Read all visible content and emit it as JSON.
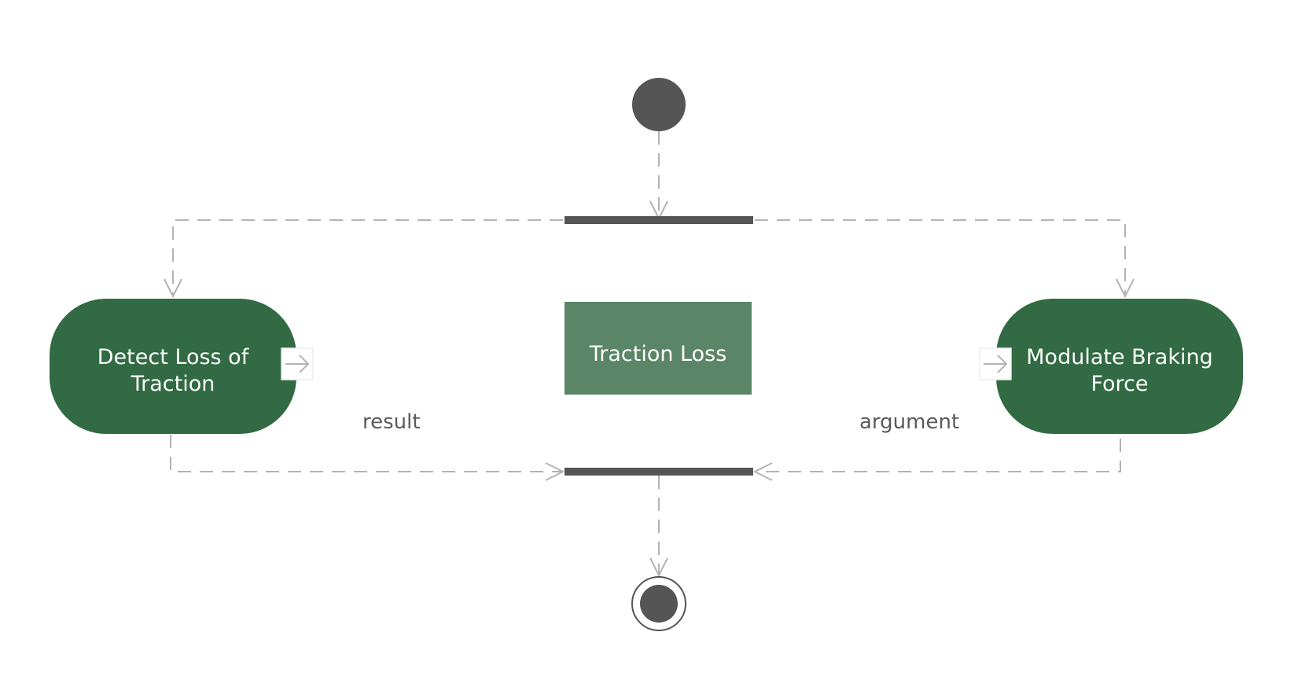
{
  "diagram": {
    "type": "UML activity diagram",
    "colors": {
      "action_fill": "#316a43",
      "object_fill": "#5a8566",
      "control_fill": "#555555",
      "flow_stroke": "#b3b3b3",
      "label_text": "#5a5a5a",
      "node_text": "#ffffff",
      "pin_fill": "#ffffff",
      "pin_stroke": "#eeeeee"
    },
    "nodes": {
      "initial": {
        "kind": "initial-node"
      },
      "fork": {
        "kind": "fork-bar"
      },
      "action_left": {
        "kind": "action",
        "lines": [
          "Detect Loss of",
          "Traction"
        ],
        "pin": "output"
      },
      "object": {
        "kind": "object-node",
        "label": "Traction Loss"
      },
      "action_right": {
        "kind": "action",
        "lines": [
          "Modulate Braking",
          "Force"
        ],
        "pin": "input"
      },
      "join": {
        "kind": "join-bar"
      },
      "final": {
        "kind": "final-node"
      }
    },
    "labels": {
      "result": "result",
      "argument": "argument"
    },
    "flows": [
      {
        "from": "initial",
        "to": "fork"
      },
      {
        "from": "fork",
        "to": "action_left"
      },
      {
        "from": "fork",
        "to": "action_right"
      },
      {
        "from": "action_left",
        "to": "join"
      },
      {
        "from": "action_right",
        "to": "join"
      },
      {
        "from": "join",
        "to": "final"
      }
    ]
  }
}
